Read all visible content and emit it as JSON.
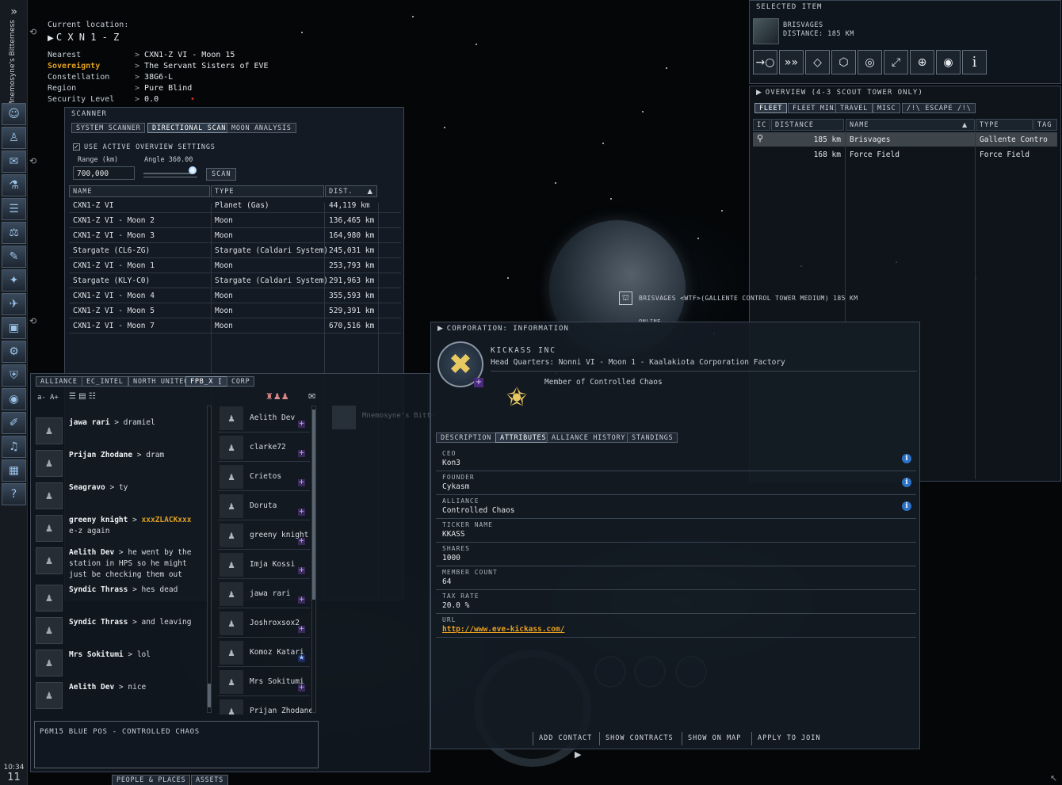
{
  "sidebar": {
    "ship_name": "Mnemosyne's Bitterness",
    "toggle": "»",
    "clock_time": "10:34",
    "clock_day": "11",
    "buttons": [
      {
        "icon": "captain-icon",
        "glyph": "☺"
      },
      {
        "icon": "people-icon",
        "glyph": "♙"
      },
      {
        "icon": "mail-icon",
        "glyph": "✉"
      },
      {
        "icon": "science-icon",
        "glyph": "⚗"
      },
      {
        "icon": "journal-icon",
        "glyph": "☰"
      },
      {
        "icon": "market-icon",
        "glyph": "⚖"
      },
      {
        "icon": "contracts-icon",
        "glyph": "✎"
      },
      {
        "icon": "map-icon",
        "glyph": "✦"
      },
      {
        "icon": "fleet-icon",
        "glyph": "✈"
      },
      {
        "icon": "assets-icon",
        "glyph": "▣"
      },
      {
        "icon": "corporation-icon",
        "glyph": "⚙"
      },
      {
        "icon": "alliance-icon",
        "glyph": "⛨"
      },
      {
        "icon": "planet-icon",
        "glyph": "◉"
      },
      {
        "icon": "notepad-icon",
        "glyph": "✐"
      },
      {
        "icon": "audio-icon",
        "glyph": "♫"
      },
      {
        "icon": "calculator-icon",
        "glyph": "▦"
      },
      {
        "icon": "help-icon",
        "glyph": "?"
      }
    ]
  },
  "location": {
    "label": "Current location:",
    "system": "C X N 1 - Z",
    "rows": [
      {
        "key": "Nearest",
        "value": "CXN1-Z VI - Moon 15"
      },
      {
        "key": "Sovereignty",
        "value": "The Servant Sisters of EVE",
        "highlight": "#e0a020"
      },
      {
        "key": "Constellation",
        "value": "38G6-L"
      },
      {
        "key": "Region",
        "value": "Pure Blind"
      },
      {
        "key": "Security Level",
        "value": "0.0"
      }
    ]
  },
  "scanner": {
    "title": "SCANNER",
    "tabs": [
      "SYSTEM SCANNER",
      "DIRECTIONAL SCAN",
      "MOON ANALYSIS"
    ],
    "active_tab": 1,
    "use_overview": "USE ACTIVE OVERVIEW SETTINGS",
    "range_label": "Range (km)",
    "range_value": "700,000",
    "angle_label": "Angle 360.00",
    "angle_fraction": 1.0,
    "scan_button": "SCAN",
    "columns": [
      "NAME",
      "TYPE",
      "DIST."
    ],
    "rows": [
      {
        "name": "CXN1-Z VI",
        "type": "Planet (Gas)",
        "dist": "44,119 km"
      },
      {
        "name": "CXN1-Z VI - Moon 2",
        "type": "Moon",
        "dist": "136,465 km"
      },
      {
        "name": "CXN1-Z VI - Moon 3",
        "type": "Moon",
        "dist": "164,980 km"
      },
      {
        "name": "Stargate (CL6-ZG)",
        "type": "Stargate (Caldari System)",
        "dist": "245,031 km"
      },
      {
        "name": "CXN1-Z VI - Moon 1",
        "type": "Moon",
        "dist": "253,793 km"
      },
      {
        "name": "Stargate (KLY-C0)",
        "type": "Stargate (Caldari System)",
        "dist": "291,963 km"
      },
      {
        "name": "CXN1-Z VI - Moon 4",
        "type": "Moon",
        "dist": "355,593 km"
      },
      {
        "name": "CXN1-Z VI - Moon 5",
        "type": "Moon",
        "dist": "529,391 km"
      },
      {
        "name": "CXN1-Z VI - Moon 7",
        "type": "Moon",
        "dist": "670,516 km"
      }
    ]
  },
  "selected": {
    "title": "SELECTED ITEM",
    "name": "BRISVAGES",
    "distance": "DISTANCE: 185 KM",
    "actions": [
      {
        "icon": "approach-icon",
        "glyph": "→○"
      },
      {
        "icon": "warp-icon",
        "glyph": "»»"
      },
      {
        "icon": "open-cargo-icon",
        "glyph": "◇"
      },
      {
        "icon": "board-icon",
        "glyph": "⬡"
      },
      {
        "icon": "orbit-icon",
        "glyph": "◎"
      },
      {
        "icon": "keep-range-icon",
        "glyph": "⤢"
      },
      {
        "icon": "lock-target-icon",
        "glyph": "⊕"
      },
      {
        "icon": "look-at-icon",
        "glyph": "◉"
      },
      {
        "icon": "info-icon",
        "glyph": "i"
      }
    ]
  },
  "overview": {
    "title": "OVERVIEW (4-3 SCOUT TOWER ONLY)",
    "tabs": [
      "FLEET",
      "FLEET MINI",
      "TRAVEL",
      "MISC",
      "/!\\ ESCAPE /!\\"
    ],
    "active_tab": 0,
    "columns": [
      "IC",
      "DISTANCE",
      "NAME",
      "TYPE",
      "TAG"
    ],
    "rows": [
      {
        "distance": "185 km",
        "name": "Brisvages",
        "type": "Gallente Contro",
        "selected": true
      },
      {
        "distance": "168 km",
        "name": "Force Field",
        "type": "Force Field",
        "selected": false
      }
    ]
  },
  "bracket": {
    "label": "BRISVAGES <WTF>(GALLENTE CONTROL TOWER MEDIUM) 185 KM",
    "status": "ONLINE"
  },
  "chat": {
    "tabs": [
      "ALLIANCE",
      "EC_INTEL",
      "NORTH UNITEC",
      "FPB_X [",
      "CORP"
    ],
    "active_tab": 3,
    "font_small": "a-",
    "font_large": "A+",
    "messages": [
      {
        "name": "jawa rari",
        "text": "dramiel"
      },
      {
        "name": "Prijan Zhodane",
        "text": "dram"
      },
      {
        "name": "Seagravo",
        "text": "ty"
      },
      {
        "name": "greeny knight",
        "text": "xxxZLACKxxx",
        "text2": "e-z again",
        "highlight": true
      },
      {
        "name": "Aelith Dev",
        "text": "he went by the station in HPS so he might just be checking them out"
      },
      {
        "name": "Syndic Thrass",
        "text": "hes dead"
      },
      {
        "name": "Syndic Thrass",
        "text": "and leaving"
      },
      {
        "name": "Mrs Sokitumi",
        "text": "lol"
      },
      {
        "name": "Aelith Dev",
        "text": "nice"
      }
    ],
    "members": [
      "Aelith Dev",
      "clarke72",
      "Crietos",
      "Doruta",
      "greeny knight",
      "Imja Kossi",
      "jawa rari",
      "Joshroxsox2",
      "Komoz Katari",
      "Mrs Sokitumi",
      "Prijan Zhodane"
    ],
    "motd": "P6M15 BLUE POS - CONTROLLED CHAOS",
    "ghost_name": "Mnemosyne's Bitte"
  },
  "corp": {
    "title": "CORPORATION: INFORMATION",
    "name": "KICKASS INC",
    "hq": "Head Quarters: Nonni VI - Moon 1 - Kaalakiota Corporation Factory",
    "member_of": "Member of Controlled Chaos",
    "tabs": [
      "DESCRIPTION",
      "ATTRIBUTES",
      "ALLIANCE HISTORY",
      "STANDINGS"
    ],
    "active_tab": 1,
    "attributes": [
      {
        "key": "CEO",
        "value": "Kon3",
        "info": true
      },
      {
        "key": "FOUNDER",
        "value": "Cykasm",
        "info": true
      },
      {
        "key": "ALLIANCE",
        "value": "Controlled Chaos",
        "info": true
      },
      {
        "key": "TICKER NAME",
        "value": "KKASS",
        "info": false
      },
      {
        "key": "SHARES",
        "value": "1000",
        "info": false
      },
      {
        "key": "MEMBER COUNT",
        "value": "64",
        "info": false
      },
      {
        "key": "TAX RATE",
        "value": "20.0 %",
        "info": false
      },
      {
        "key": "URL",
        "value": "http://www.eve-kickass.com/",
        "info": false,
        "link": true
      }
    ],
    "buttons": [
      "ADD CONTACT",
      "SHOW CONTRACTS",
      "SHOW ON MAP",
      "APPLY TO JOIN"
    ]
  },
  "bottom_tabs": [
    "PEOPLE & PLACES",
    "ASSETS"
  ],
  "colors": {
    "accent": "#e0a020",
    "link": "#e8a020",
    "info": "#2e72c8",
    "security": "#e03020"
  }
}
